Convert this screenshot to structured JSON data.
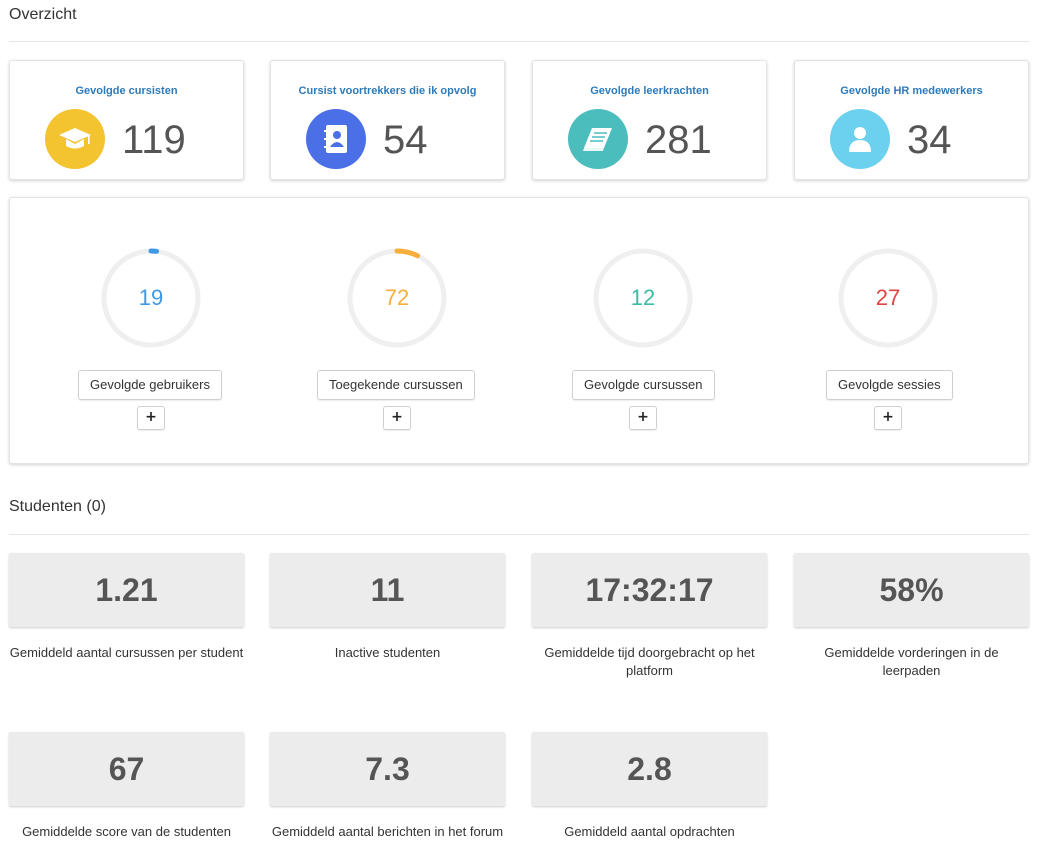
{
  "overview": {
    "title": "Overzicht",
    "cards": [
      {
        "title": "Gevolgde cursisten",
        "value": "119",
        "icon": "graduation-cap-icon",
        "color": "#f3c330"
      },
      {
        "title": "Cursist voortrekkers die ik opvolg",
        "value": "54",
        "icon": "contact-book-icon",
        "color": "#4a6fe6"
      },
      {
        "title": "Gevolgde leerkrachten",
        "value": "281",
        "icon": "book-icon",
        "color": "#4bbdbd"
      },
      {
        "title": "Gevolgde HR medewerkers",
        "value": "34",
        "icon": "user-icon",
        "color": "#6cd0ef"
      }
    ]
  },
  "progress": {
    "items": [
      {
        "value": "19",
        "percent": 0.019,
        "color": "#3e99e6",
        "label": "Gevolgde gebruikers",
        "add": "+"
      },
      {
        "value": "72",
        "percent": 0.072,
        "color": "#f6ae3c",
        "label": "Toegekende cursussen",
        "add": "+"
      },
      {
        "value": "12",
        "percent": 0.0,
        "color": "#3dbba4",
        "label": "Gevolgde cursussen",
        "add": "+"
      },
      {
        "value": "27",
        "percent": 0.0,
        "color": "#e04343",
        "label": "Gevolgde sessies",
        "add": "+"
      }
    ]
  },
  "students": {
    "title": "Studenten (0)",
    "metrics": [
      {
        "value": "1.21",
        "label": "Gemiddeld aantal cursussen per student"
      },
      {
        "value": "11",
        "label": "Inactive studenten"
      },
      {
        "value": "17:32:17",
        "label": "Gemiddelde tijd doorgebracht op het platform"
      },
      {
        "value": "58%",
        "label": "Gemiddelde vorderingen in de leerpaden"
      },
      {
        "value": "67",
        "label": "Gemiddelde score van de studenten"
      },
      {
        "value": "7.3",
        "label": "Gemiddeld aantal berichten in het forum"
      },
      {
        "value": "2.8",
        "label": "Gemiddeld aantal opdrachten"
      }
    ]
  }
}
